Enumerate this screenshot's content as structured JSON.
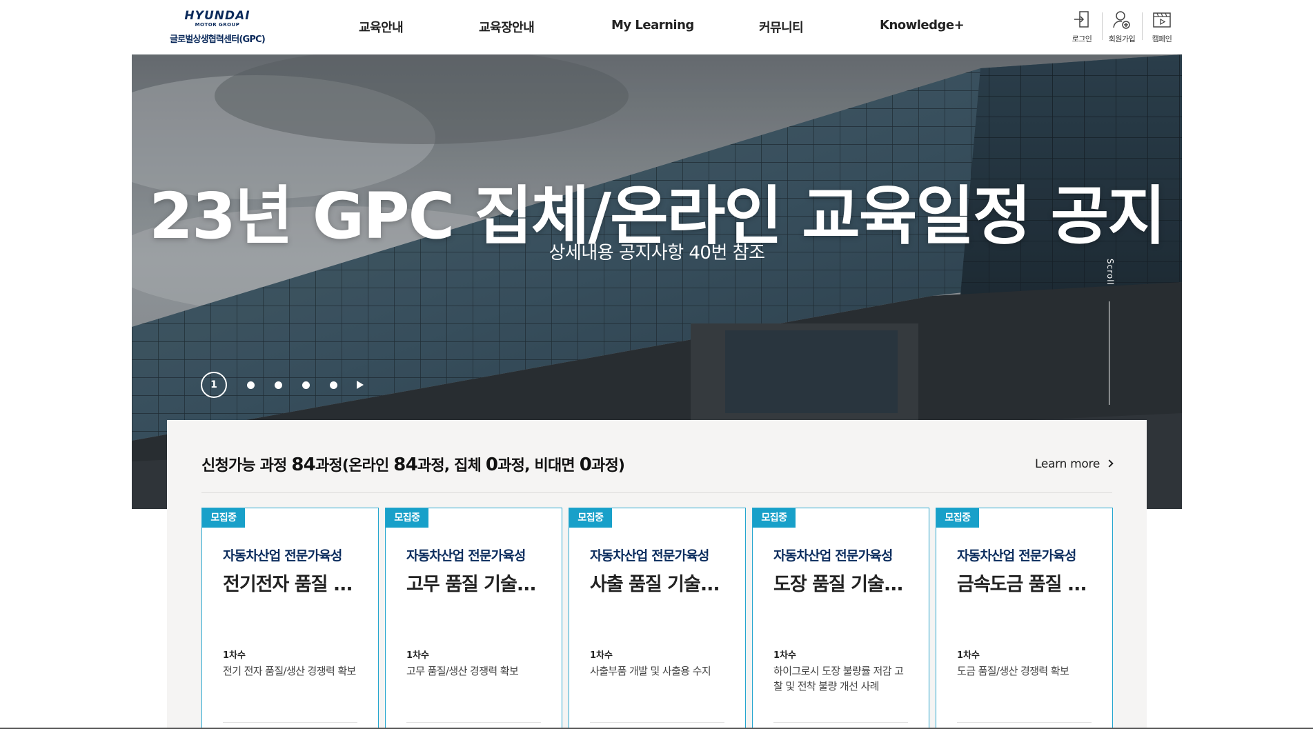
{
  "header": {
    "logo": {
      "brand": "HYUNDAI",
      "sub": "MOTOR GROUP",
      "center": "글로벌상생협력센터(GPC)"
    },
    "nav": [
      {
        "label": "교육안내"
      },
      {
        "label": "교육장안내"
      },
      {
        "label": "My Learning"
      },
      {
        "label": "커뮤니티"
      },
      {
        "label": "Knowledge+"
      }
    ],
    "util": [
      {
        "label": "로그인",
        "icon": "login-icon"
      },
      {
        "label": "회원가입",
        "icon": "user-add-icon"
      },
      {
        "label": "캠페인",
        "icon": "video-icon"
      }
    ]
  },
  "hero": {
    "title": "23년 GPC 집체/온라인 교육일정 공지",
    "subtitle": "상세내용 공지사항 40번 참조",
    "scroll_label": "Scroll",
    "pager": {
      "current": "1",
      "dot_count": 4
    }
  },
  "courses": {
    "title_parts": {
      "prefix": "신청가능 과정 ",
      "total": "84",
      "mid1": "과정(온라인 ",
      "online": "84",
      "mid2": "과정, 집체 ",
      "offline": "0",
      "mid3": "과정, 비대면 ",
      "remote": "0",
      "suffix": "과정)"
    },
    "learn_more": "Learn more",
    "items": [
      {
        "badge": "모집중",
        "category": "자동차산업 전문가육성",
        "title": "전기전자 품질 ...",
        "round": "1차수",
        "desc": "전기 전자 품질/생산 경쟁력 확보"
      },
      {
        "badge": "모집중",
        "category": "자동차산업 전문가육성",
        "title": "고무 품질 기술...",
        "round": "1차수",
        "desc": "고무 품질/생산 경쟁력 확보"
      },
      {
        "badge": "모집중",
        "category": "자동차산업 전문가육성",
        "title": "사출 품질 기술...",
        "round": "1차수",
        "desc": "사출부품 개발 및 사출용 수지"
      },
      {
        "badge": "모집중",
        "category": "자동차산업 전문가육성",
        "title": "도장 품질 기술...",
        "round": "1차수",
        "desc": "하이그로시 도장 불량률 저감 고찰 및 전착 불량 개선 사례"
      },
      {
        "badge": "모집중",
        "category": "자동차산업 전문가육성",
        "title": "금속도금 품질 ...",
        "round": "1차수",
        "desc": "도금 품질/생산 경쟁력 확보"
      }
    ]
  },
  "colors": {
    "brand_navy": "#0c2d5e",
    "badge_blue": "#18a0c9",
    "panel_bg": "#f5f4f3"
  }
}
